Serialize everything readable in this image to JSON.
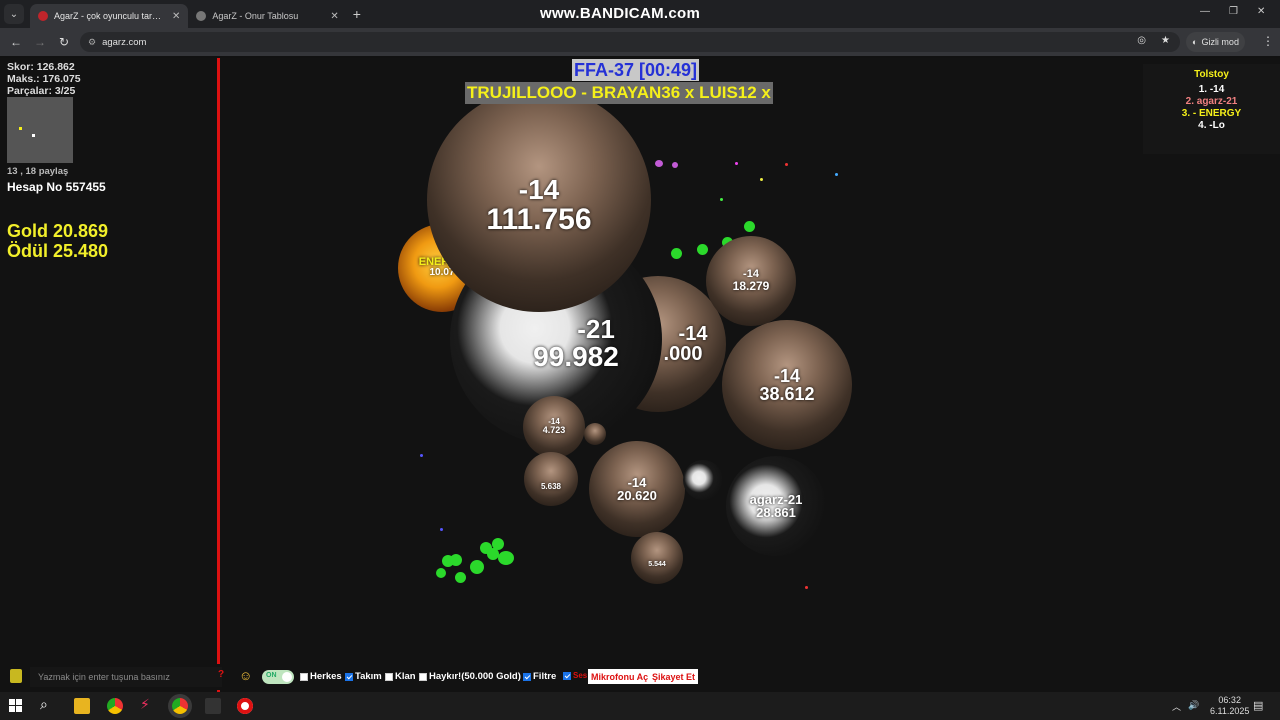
{
  "browser": {
    "tabs": [
      {
        "title": "AgarZ - çok oyunculu tarayıcı oyunu",
        "active": true
      },
      {
        "title": "AgarZ - Onur Tablosu",
        "active": false
      }
    ],
    "watermark": "www.BANDICAM.com",
    "url": "agarz.com",
    "incognito_label": "Gizli mod"
  },
  "hud": {
    "score": "Skor: 126.862",
    "max": "Maks.: 176.075",
    "pieces": "Parçalar: 3/25",
    "coords": "13 , 18 paylaş",
    "account": "Hesap No 557455",
    "gold": "Gold 20.869",
    "reward": "Ödül 25.480"
  },
  "server": "FFA-37 [00:49]",
  "clan_banner": "TRUJILLOOO - BRAYAN36 x LUIS12 x",
  "leaderboard": {
    "title": "Tolstoy",
    "rows": [
      {
        "text": "1. -14",
        "color": "#ffffff"
      },
      {
        "text": "2. agarz-21",
        "color": "#f08080"
      },
      {
        "text": "3. - ΕΝΕRGY",
        "color": "#f5f01a"
      },
      {
        "text": "4. -Lo",
        "color": "#ffffff"
      }
    ]
  },
  "cells": {
    "c1": {
      "name": "-14",
      "mass": "111.756"
    },
    "c2": {
      "name": "-21",
      "mass": "99.982"
    },
    "c3": {
      "name": "-14",
      "mass": ".000"
    },
    "c4": {
      "name": "-14",
      "mass": "18.279"
    },
    "c5": {
      "name": "-14",
      "mass": "38.612"
    },
    "c6": {
      "name": "-14",
      "mass": "20.620"
    },
    "c7": {
      "name": "agarz-21",
      "mass": "28.861"
    },
    "c8": {
      "name": "-14",
      "mass": "4.723"
    },
    "c9": {
      "name": "",
      "mass": "5.638"
    },
    "c10": {
      "name": "",
      "mass": "5.544"
    },
    "c11": {
      "name": "ΕΝΕRGY",
      "mass": "10.07"
    }
  },
  "controls": {
    "chat_placeholder": "Yazmak için enter tuşuna basınız",
    "toggle": "ON",
    "everyone": "Herkes",
    "team": "Takım",
    "clan": "Klan",
    "shout": "Haykır!(50.000 Gold)",
    "filter": "Filtre",
    "sound": "Ses",
    "mic": "Mikrofonu Aç",
    "report": "Şikayet Et"
  },
  "taskbar": {
    "time": "06:32",
    "date": "6.11.2025"
  },
  "colors": {
    "gold_text": "#f2ef2a",
    "server_text": "#2531d6",
    "border": "#dd1111"
  }
}
